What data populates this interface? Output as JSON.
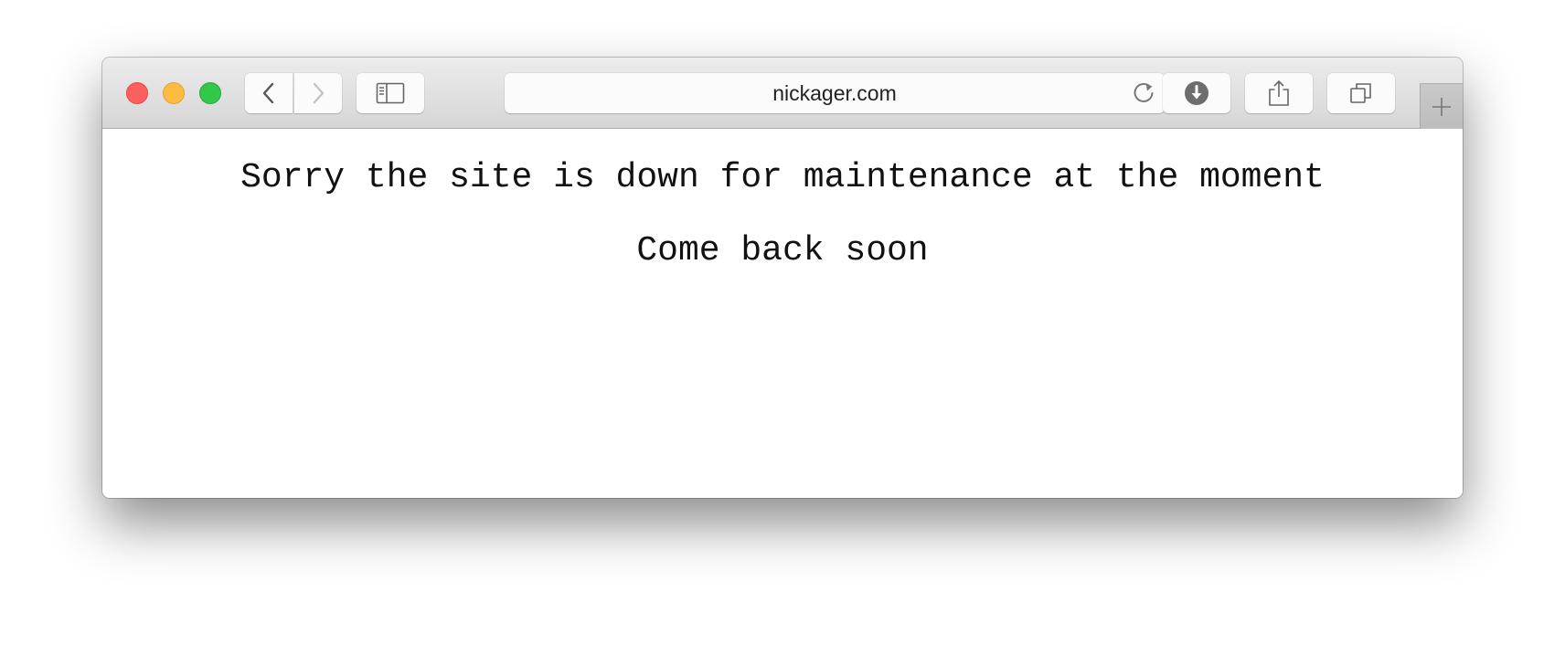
{
  "browser": {
    "address_bar": {
      "url": "nickager.com"
    },
    "icons": {
      "back": "chevron-left-icon",
      "forward": "chevron-right-icon",
      "sidebar": "sidebar-icon",
      "reload": "reload-icon",
      "download": "download-icon",
      "share": "share-icon",
      "tabs": "tabs-overview-icon",
      "new_tab": "plus-icon"
    },
    "traffic_light_colors": {
      "close": "#fc605c",
      "minimize": "#fdbc40",
      "maximize": "#34c84a"
    }
  },
  "page": {
    "message": "Sorry the site is down for maintenance at the moment",
    "submessage": "Come back soon"
  }
}
